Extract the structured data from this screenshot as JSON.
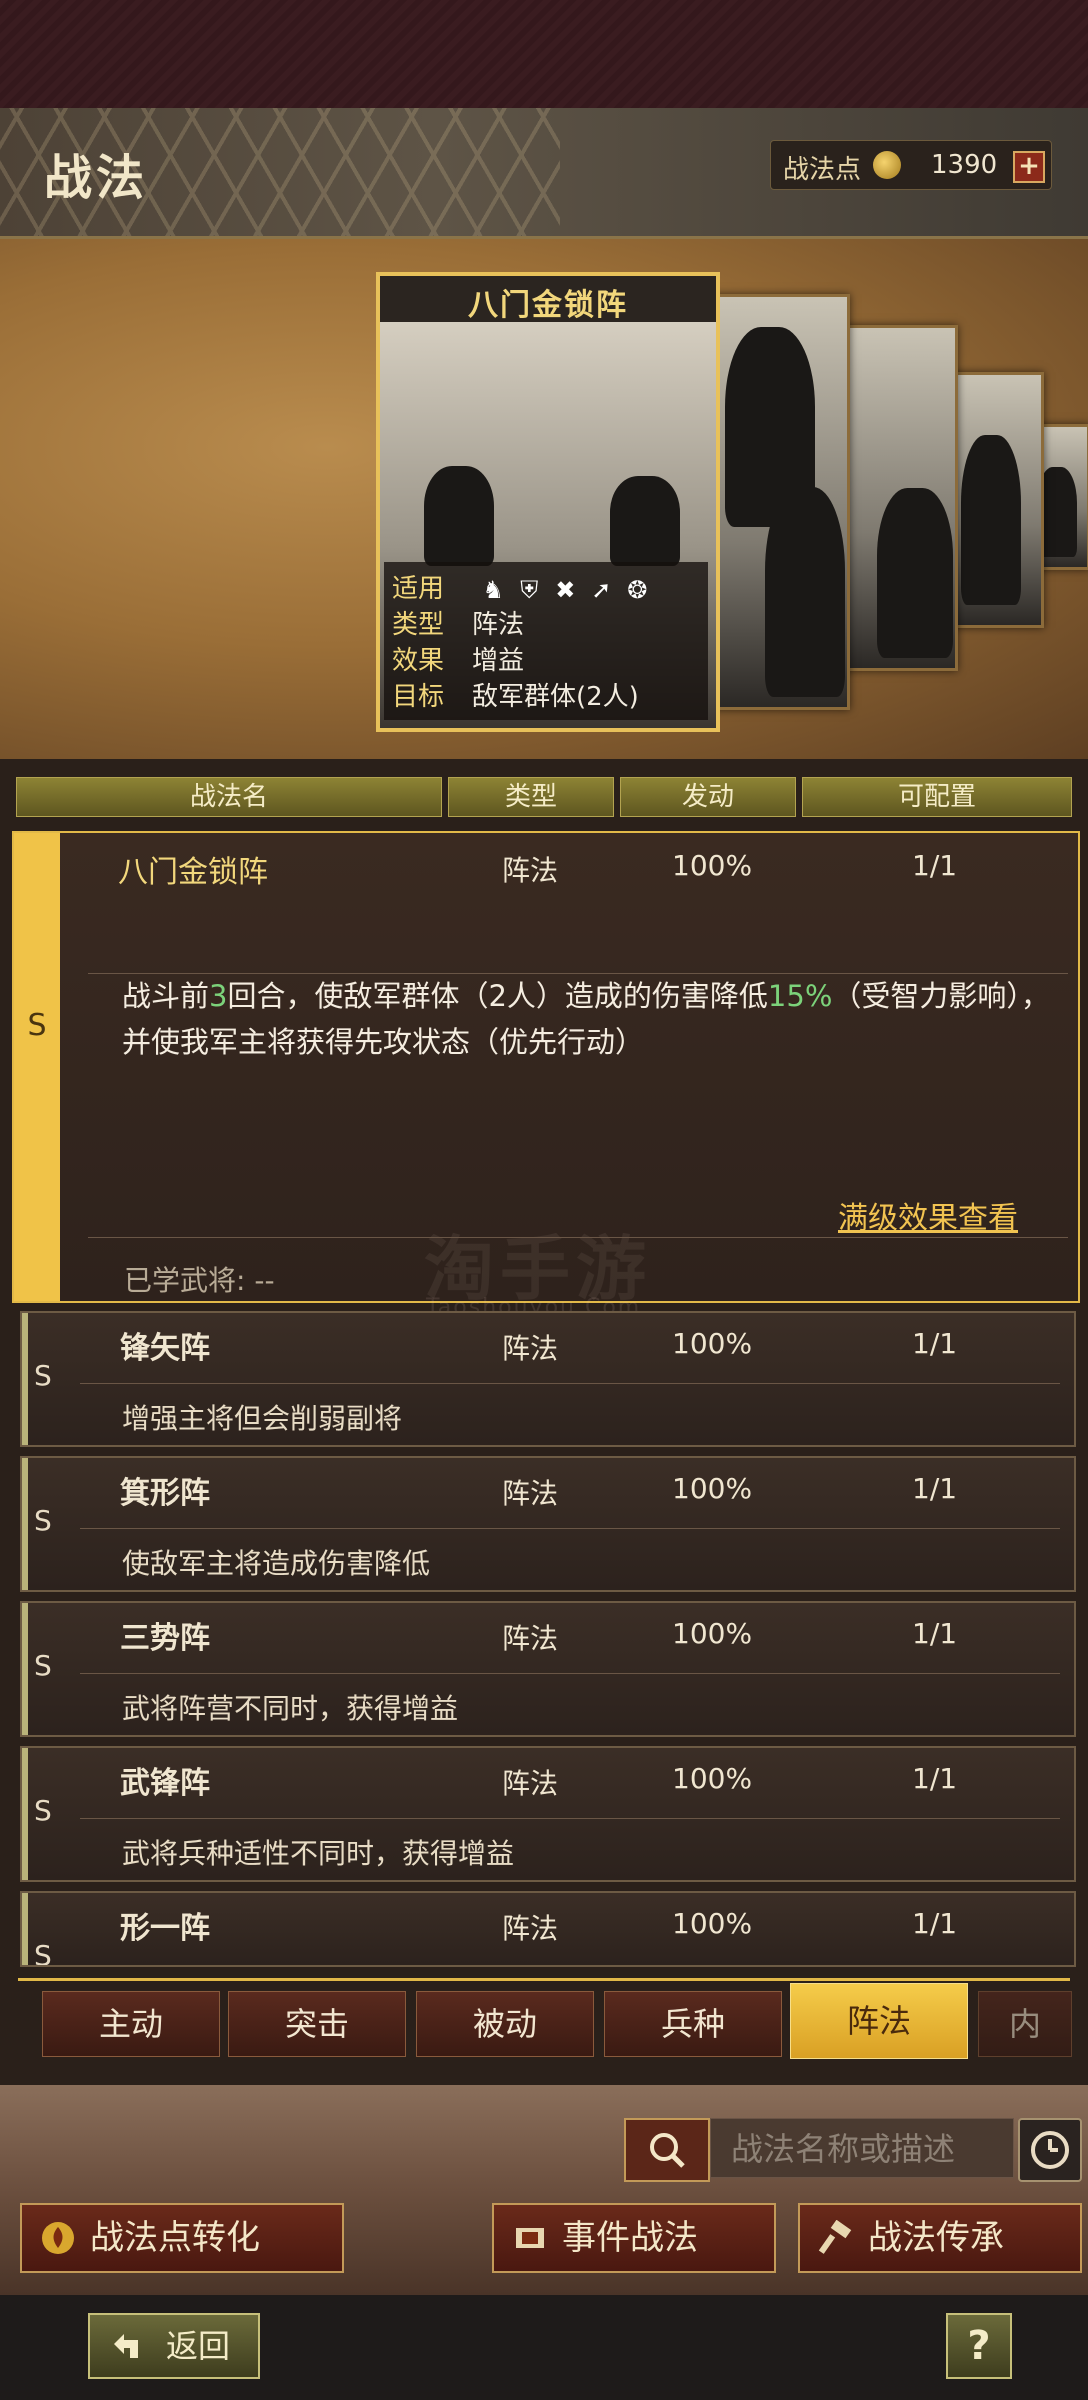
{
  "header": {
    "title": "战法",
    "points_label": "战法点",
    "points_value": "1390",
    "add_label": "+"
  },
  "featured": {
    "name": "八门金锁阵",
    "applicable_label": "适用",
    "type_label": "类型",
    "type_value": "阵法",
    "effect_label": "效果",
    "effect_value": "增益",
    "target_label": "目标",
    "target_value": "敌军群体(2人)",
    "unit_icons": [
      "cavalry-icon",
      "shield-icon",
      "archer-icon",
      "spear-icon",
      "siege-wheel-icon"
    ]
  },
  "columns": {
    "name": "战法名",
    "type": "类型",
    "trigger": "发动",
    "config": "可配置"
  },
  "selected": {
    "grade": "S",
    "name": "八门金锁阵",
    "type": "阵法",
    "trigger": "100%",
    "config": "1/1",
    "desc_part1": "战斗前",
    "desc_num1": "3",
    "desc_part2": "回合，使敌军群体（2人）造成的伤害降低",
    "desc_num2": "15%",
    "desc_part3": "（受智力影响），并使我军主将获得先攻状态（优先行动）",
    "max_link": "满级效果查看",
    "learned": "已学武将: --"
  },
  "rows": [
    {
      "grade": "S",
      "name": "锋矢阵",
      "type": "阵法",
      "trigger": "100%",
      "config": "1/1",
      "desc": "增强主将但会削弱副将"
    },
    {
      "grade": "S",
      "name": "箕形阵",
      "type": "阵法",
      "trigger": "100%",
      "config": "1/1",
      "desc": "使敌军主将造成伤害降低"
    },
    {
      "grade": "S",
      "name": "三势阵",
      "type": "阵法",
      "trigger": "100%",
      "config": "1/1",
      "desc": "武将阵营不同时，获得增益"
    },
    {
      "grade": "S",
      "name": "武锋阵",
      "type": "阵法",
      "trigger": "100%",
      "config": "1/1",
      "desc": "武将兵种适性不同时，获得增益"
    },
    {
      "grade": "S",
      "name": "形一阵",
      "type": "阵法",
      "trigger": "100%",
      "config": "1/1",
      "desc": ""
    }
  ],
  "tabs": [
    "主动",
    "突击",
    "被动",
    "兵种",
    "阵法",
    "内"
  ],
  "active_tab": "阵法",
  "search": {
    "placeholder": "战法名称或描述"
  },
  "actions": {
    "convert": "战法点转化",
    "event": "事件战法",
    "inherit": "战法传承"
  },
  "footer": {
    "back": "返回",
    "help": "?"
  },
  "watermark": {
    "text": "淘手游",
    "sub": "Taoshouyou.Com"
  }
}
